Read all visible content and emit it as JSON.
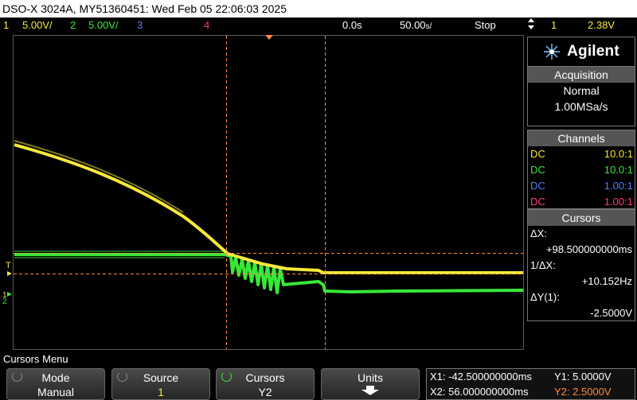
{
  "title_bar": "DSO-X 3024A, MY51360451: Wed Feb 05 22:06:03 2025",
  "status": {
    "ch1_num": "1",
    "ch1_scale": "5.00V/",
    "ch2_num": "2",
    "ch2_scale": "5.00V/",
    "ch3_num": "3",
    "ch4_num": "4",
    "time_offset": "0.0s",
    "time_scale": "50.00",
    "time_unit": "s/",
    "run_state": "Stop",
    "trig_icon": "trigger-edge-icon",
    "trig_source": "1",
    "trig_level": "2.38V"
  },
  "panel": {
    "brand": "Agilent",
    "acquisition_title": "Acquisition",
    "acq_mode": "Normal",
    "acq_rate": "1.00MSa/s",
    "channels_title": "Channels",
    "channels": [
      {
        "coupling": "DC",
        "probe": "10.0:1",
        "color": "#f5e83a"
      },
      {
        "coupling": "DC",
        "probe": "10.0:1",
        "color": "#38e838"
      },
      {
        "coupling": "DC",
        "probe": "1.00:1",
        "color": "#5b78ff"
      },
      {
        "coupling": "DC",
        "probe": "1.00:1",
        "color": "#ff3a7a"
      }
    ],
    "cursors_title": "Cursors",
    "dx_label": "ΔX:",
    "dx_value": "+98.500000000ms",
    "inv_dx_label": "1/ΔX:",
    "inv_dx_value": "+10.152Hz",
    "dy_label": "ΔY(1):",
    "dy_value": "-2.5000V"
  },
  "menu_title": "Cursors Menu",
  "softkeys": [
    {
      "top": "Mode",
      "bottom": "Manual"
    },
    {
      "top": "Source",
      "bottom": "1"
    },
    {
      "top": "Cursors",
      "bottom": "Y2"
    },
    {
      "top": "Units",
      "bottom": ""
    }
  ],
  "readout": {
    "x1": "X1: -42.500000000ms",
    "x2": "X2: 56.000000000ms",
    "y1": "Y1: 5.0000V",
    "y2": "Y2: 2.5000V"
  },
  "markers": {
    "trigger": "T",
    "ch1_ground": "1",
    "ch2_ground": "2"
  },
  "colors": {
    "ch1": "#f5e83a",
    "ch2": "#38e838",
    "ch3": "#5b78ff",
    "ch4": "#ff3a7a",
    "cursor": "#ff8a3a",
    "grid": "#5a5a5a"
  }
}
